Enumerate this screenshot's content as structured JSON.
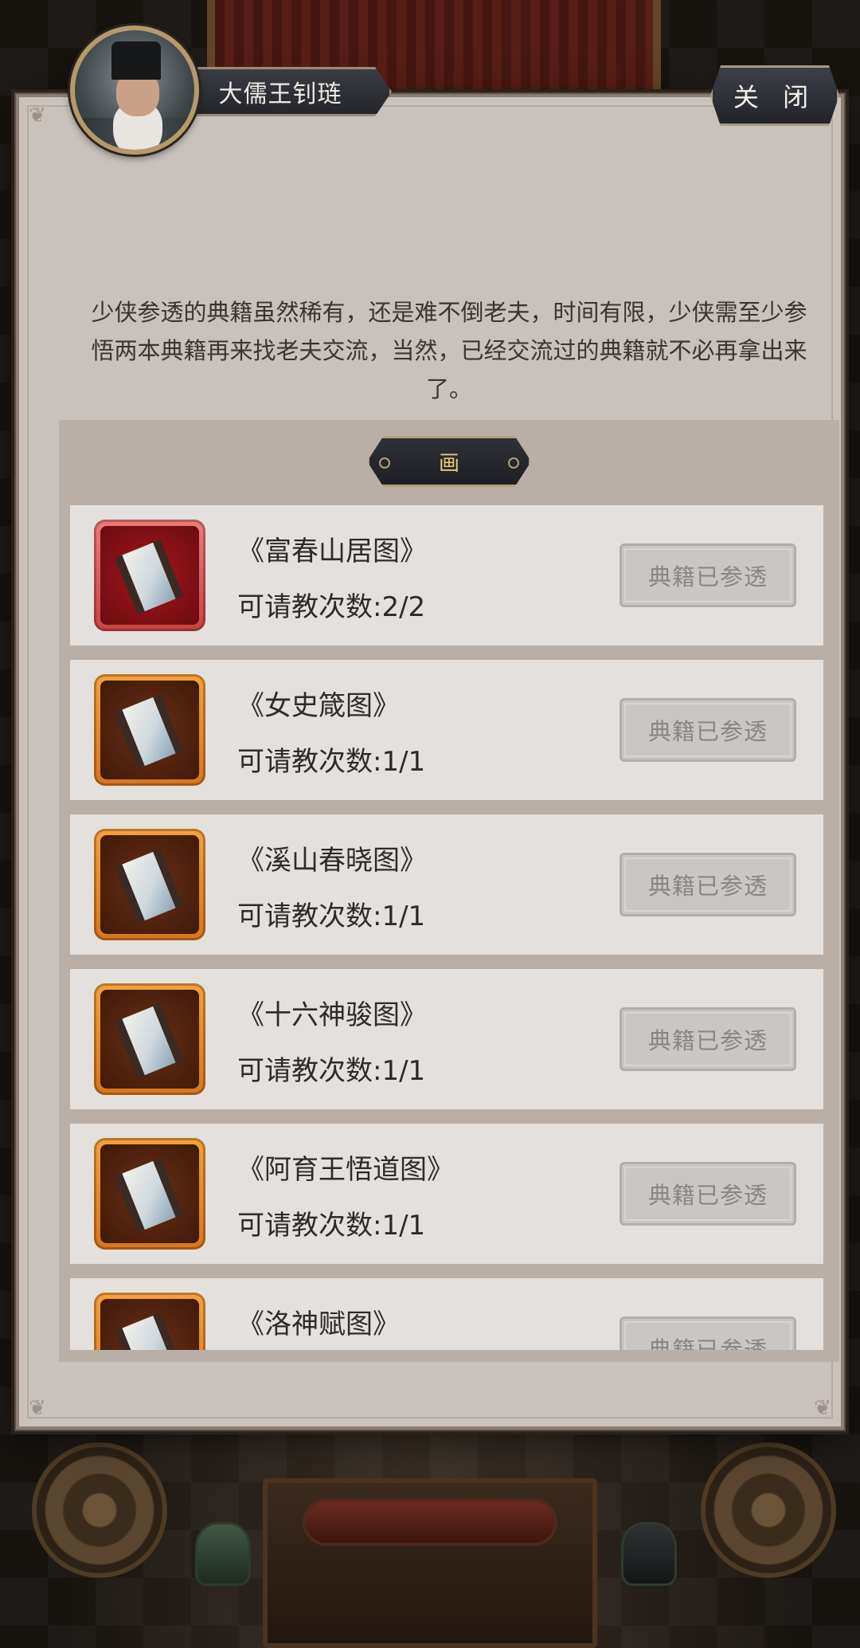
{
  "npc": {
    "name": "大儒王钊琏"
  },
  "close_label": "关 闭",
  "intro_text": "少侠参透的典籍虽然稀有，还是难不倒老夫，时间有限，少侠需至少参悟两本典籍再来找老夫交流，当然，已经交流过的典籍就不必再拿出来了。",
  "category": "画",
  "books": [
    {
      "title": "《富春山居图》",
      "count": "可请教次数:2/2",
      "status": "典籍已参透",
      "rarity": "red"
    },
    {
      "title": "《女史箴图》",
      "count": "可请教次数:1/1",
      "status": "典籍已参透",
      "rarity": "orange"
    },
    {
      "title": "《溪山春晓图》",
      "count": "可请教次数:1/1",
      "status": "典籍已参透",
      "rarity": "orange"
    },
    {
      "title": "《十六神骏图》",
      "count": "可请教次数:1/1",
      "status": "典籍已参透",
      "rarity": "orange"
    },
    {
      "title": "《阿育王悟道图》",
      "count": "可请教次数:1/1",
      "status": "典籍已参透",
      "rarity": "orange"
    },
    {
      "title": "《洛神赋图》",
      "count": "",
      "status": "典籍已参透",
      "rarity": "orange"
    }
  ],
  "icons": {
    "book": "painting-scroll-icon",
    "avatar": "scholar-portrait"
  }
}
